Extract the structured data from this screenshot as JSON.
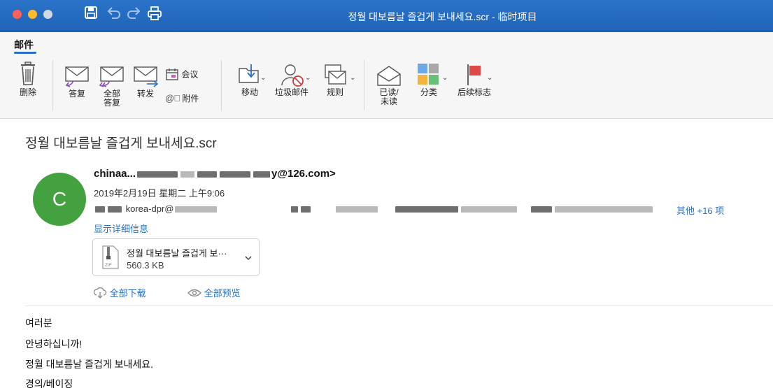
{
  "window": {
    "title": "정월 대보름날 즐겁게 보내세요.scr - 临时项目"
  },
  "ribbon": {
    "tab": "邮件",
    "delete": "删除",
    "reply": "答复",
    "reply_all_1": "全部",
    "reply_all_2": "答复",
    "forward": "转发",
    "meeting": "会议",
    "attachment": "附件",
    "move": "移动",
    "junk": "垃圾邮件",
    "rules": "规则",
    "read_unread_1": "已读/",
    "read_unread_2": "未读",
    "categorize": "分类",
    "follow_up": "后续标志"
  },
  "message": {
    "subject": "정월 대보름날 즐겁게 보내세요.scr",
    "avatar_letter": "C",
    "sender_prefix": "chinaa...",
    "sender_suffix": "y@126.com>",
    "date": "2019年2月19日 星期二 上午9:06",
    "recipient_visible": "korea-dpr@",
    "more_recipients": "其他 +16 项",
    "show_details": "显示详细信息"
  },
  "attachment": {
    "name": "정월 대보름날 즐겁게 보···",
    "size": "560.3 KB",
    "type_label": "ZIP",
    "download_all": "全部下载",
    "preview_all": "全部预览"
  },
  "body": {
    "lines": [
      "여러분",
      "안녕하십니까!",
      "정월 대보름날 즐겁게 보내세요.",
      "경의/베이징"
    ]
  },
  "colors": {
    "title_bar": "#1f63b8",
    "link": "#2b6fc2",
    "avatar": "#43a13f"
  }
}
